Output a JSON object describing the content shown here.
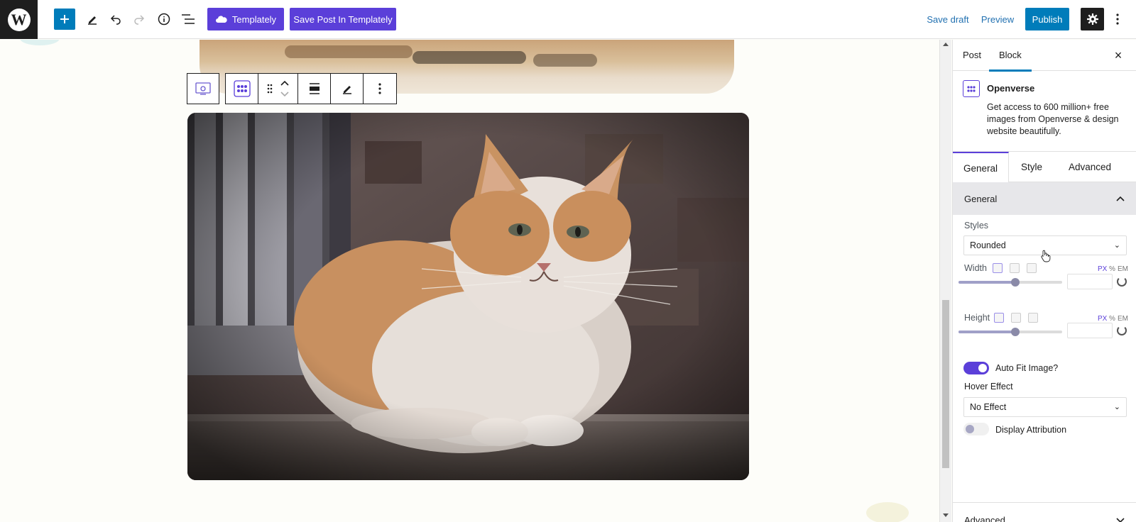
{
  "topbar": {
    "templately_label": "Templately",
    "save_templately_label": "Save Post In Templately",
    "save_draft_label": "Save draft",
    "preview_label": "Preview",
    "publish_label": "Publish"
  },
  "sidebar": {
    "tabs": [
      "Post",
      "Block"
    ],
    "block_title": "Openverse",
    "block_description": "Get access to 600 million+ free images from Openverse & design website beautifully.",
    "inspector_tabs": [
      "General",
      "Style",
      "Advanced"
    ],
    "general_panel_title": "General",
    "styles_label": "Styles",
    "styles_value": "Rounded",
    "width_label": "Width",
    "height_label": "Height",
    "units": [
      "PX",
      "%",
      "EM"
    ],
    "width_slider_fraction": 0.55,
    "height_slider_fraction": 0.55,
    "auto_fit_label": "Auto Fit Image?",
    "auto_fit_on": true,
    "hover_effect_label": "Hover Effect",
    "hover_effect_value": "No Effect",
    "display_attribution_label": "Display Attribution",
    "display_attribution_on": false,
    "advanced_panel_title": "Advanced"
  },
  "colors": {
    "accent": "#5b3fd9",
    "wp_blue": "#007cba",
    "link": "#2271b1"
  }
}
